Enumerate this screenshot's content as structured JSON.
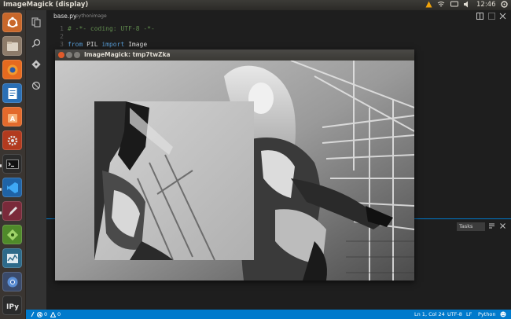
{
  "top_panel": {
    "title": "ImageMagick (display)",
    "clock": "12:46"
  },
  "launcher": {
    "items": [
      "ubuntu-dash",
      "files",
      "firefox",
      "libreoffice-writer",
      "software-center",
      "system-settings",
      "terminal",
      "vscode",
      "editor",
      "inkscape",
      "system-monitor",
      "chromium",
      "ipython"
    ]
  },
  "editor": {
    "tab_filename": "base.py",
    "tab_path": "pythonimage",
    "lines": [
      {
        "num": "1",
        "tokens": [
          {
            "t": "# -*- coding: UTF-8 -*-",
            "c": "comment"
          }
        ]
      },
      {
        "num": "2",
        "tokens": []
      },
      {
        "num": "3",
        "tokens": [
          {
            "t": "from",
            "c": "kw"
          },
          {
            "t": " PIL ",
            "c": "id"
          },
          {
            "t": "import",
            "c": "kw"
          },
          {
            "t": " Image",
            "c": "id"
          }
        ]
      }
    ],
    "panel_select": "Tasks"
  },
  "status_bar": {
    "errors": "0",
    "warnings": "0",
    "position": "Ln 1, Col 24",
    "encoding": "UTF-8",
    "eol": "LF",
    "language": "Python"
  },
  "imagemagick": {
    "window_title": "ImageMagick: tmp7twZka"
  },
  "colors": {
    "accent": "#007acc",
    "launcher_bg": "#3a3531",
    "editor_bg": "#1e1e1e"
  }
}
